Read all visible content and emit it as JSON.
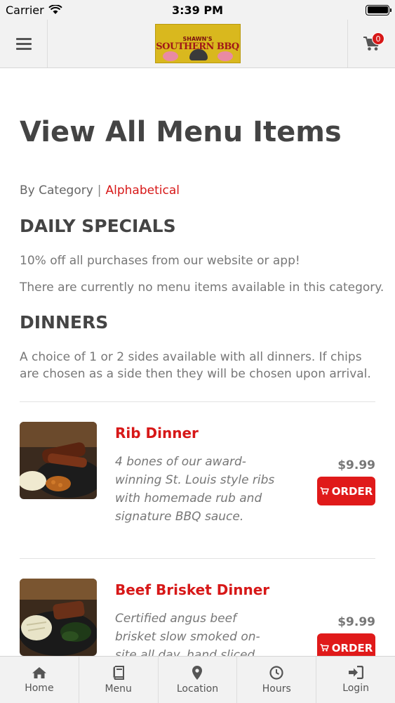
{
  "status_bar": {
    "carrier": "Carrier",
    "time": "3:39 PM"
  },
  "header": {
    "logo": {
      "line1": "SHAWN'S",
      "line2": "SOUTHERN BBQ"
    },
    "cart_count": "0"
  },
  "page": {
    "title": "View All Menu Items",
    "sort": {
      "by_category": "By Category",
      "separator": "|",
      "alphabetical": "Alphabetical"
    }
  },
  "categories": [
    {
      "title": "DAILY SPECIALS",
      "description": "10% off all purchases from our website or app!",
      "empty_message": "There are currently no menu items available in this category."
    },
    {
      "title": "DINNERS",
      "description": "A choice of 1 or 2 sides available with all dinners. If chips are chosen as a side then they will be chosen upon arrival."
    }
  ],
  "items": [
    {
      "name": "Rib Dinner",
      "description": "4 bones of our award-winning St. Louis style ribs with homemade rub and signature BBQ sauce.",
      "price": "$9.99",
      "order_label": "ORDER"
    },
    {
      "name": "Beef Brisket Dinner",
      "description": "Certified angus beef brisket slow smoked on-site all day, hand sliced, served with our",
      "price": "$9.99",
      "order_label": "ORDER"
    }
  ],
  "tabs": [
    {
      "label": "Home",
      "icon": "home-icon"
    },
    {
      "label": "Menu",
      "icon": "book-icon"
    },
    {
      "label": "Location",
      "icon": "map-pin-icon"
    },
    {
      "label": "Hours",
      "icon": "clock-icon"
    },
    {
      "label": "Login",
      "icon": "login-icon"
    }
  ],
  "colors": {
    "accent": "#d71818",
    "header_bg": "#f2f2f2",
    "text": "#555555"
  }
}
